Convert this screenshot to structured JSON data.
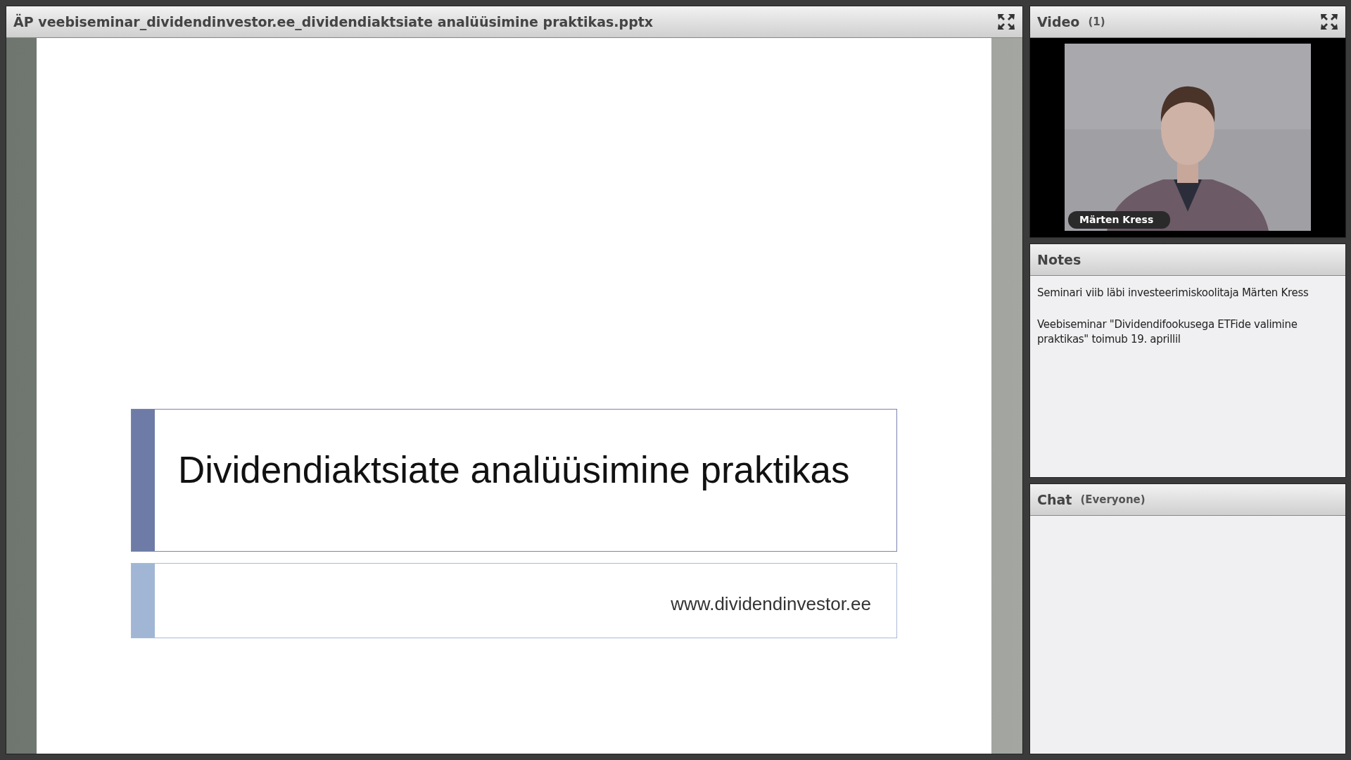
{
  "share_pod": {
    "title": "ÄP veebiseminar_dividendinvestor.ee_dividendiaktsiate analüüsimine praktikas.pptx"
  },
  "slide": {
    "title": "Dividendiaktsiate analüüsimine praktikas",
    "subtitle": "www.dividendinvestor.ee"
  },
  "video_pod": {
    "title": "Video",
    "count": "(1)",
    "feed": {
      "kind": "picture",
      "name_tag": "Märten Kress"
    }
  },
  "notes_pod": {
    "title": "Notes",
    "paragraphs": [
      "Seminari viib läbi investeerimiskoolitaja Märten Kress",
      "Veebiseminar \"Dividendifookusega ETFide valimine praktikas\" toimub 19. aprillil"
    ]
  },
  "chat_pod": {
    "title": "Chat",
    "audience": "(Everyone)"
  }
}
